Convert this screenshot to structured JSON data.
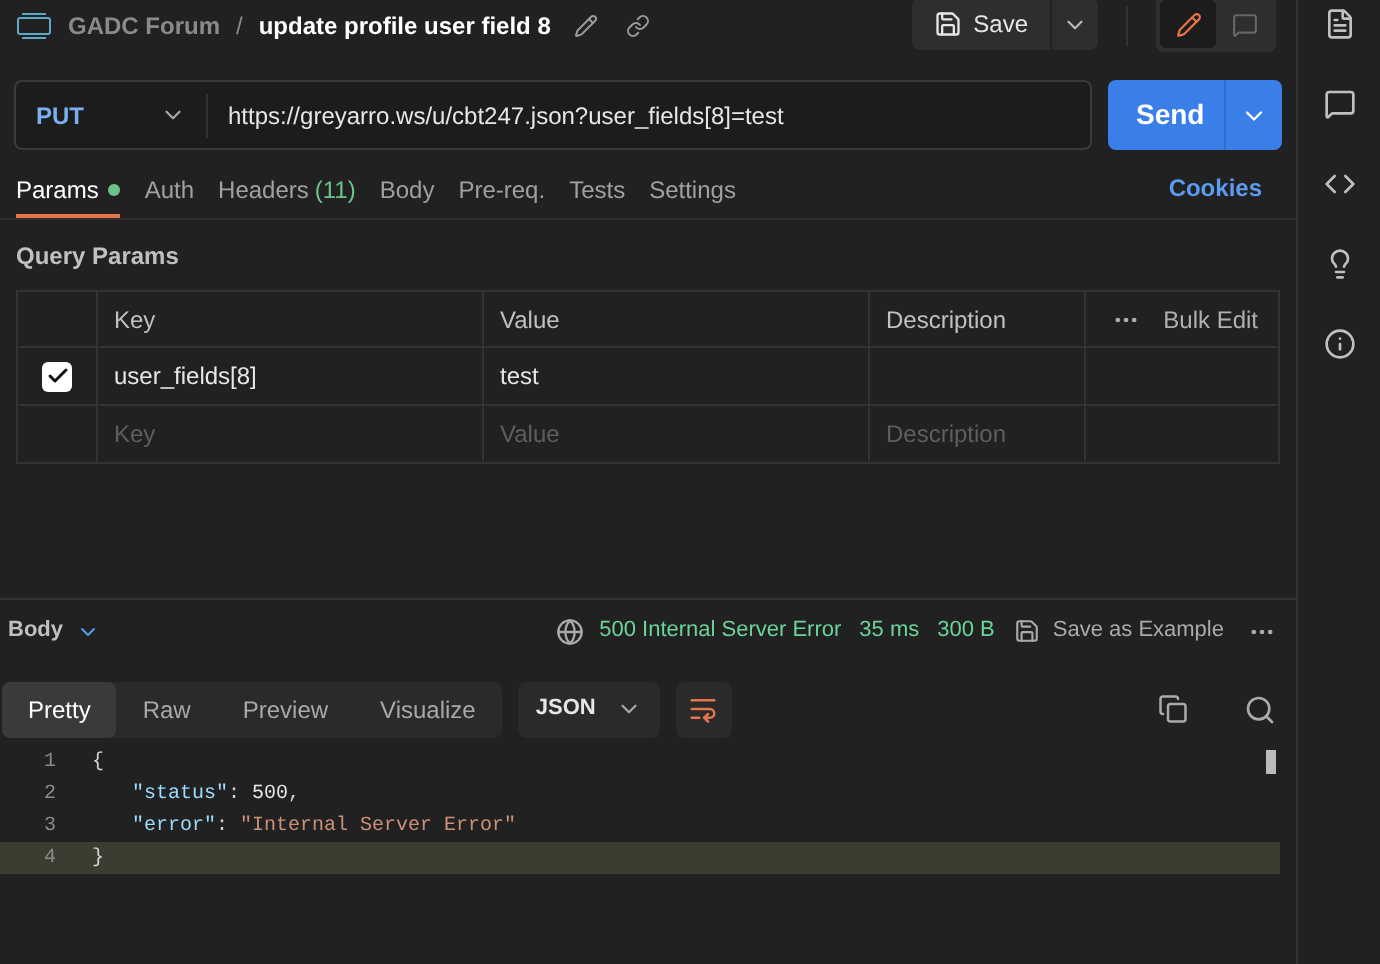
{
  "header": {
    "collection": "GADC Forum",
    "separator": "/",
    "request_name": "update profile user field 8",
    "save_label": "Save",
    "edit_mode": true
  },
  "request": {
    "method": "PUT",
    "url": "https://greyarro.ws/u/cbt247.json?user_fields[8]=test",
    "send_label": "Send"
  },
  "tabs": [
    {
      "label": "Params",
      "selected": true,
      "dot": true
    },
    {
      "label": "Auth",
      "selected": false
    },
    {
      "label": "Headers",
      "count": "(11)",
      "selected": false
    },
    {
      "label": "Body",
      "selected": false
    },
    {
      "label": "Pre-req.",
      "selected": false
    },
    {
      "label": "Tests",
      "selected": false
    },
    {
      "label": "Settings",
      "selected": false
    }
  ],
  "cookies_link": "Cookies",
  "query_params": {
    "title": "Query Params",
    "columns": [
      "Key",
      "Value",
      "Description"
    ],
    "bulk_edit": "Bulk Edit",
    "rows": [
      {
        "checked": true,
        "key": "user_fields[8]",
        "value": "test"
      }
    ],
    "placeholders": {
      "key": "Key",
      "value": "Value",
      "description": "Description"
    }
  },
  "response": {
    "section_label": "Body",
    "status": "500 Internal Server Error",
    "time": "35 ms",
    "size": "300 B",
    "save_example": "Save as Example",
    "view_tabs": [
      {
        "label": "Pretty",
        "selected": true
      },
      {
        "label": "Raw",
        "selected": false
      },
      {
        "label": "Preview",
        "selected": false
      },
      {
        "label": "Visualize",
        "selected": false
      }
    ],
    "format": "JSON",
    "lines": [
      {
        "number": "1",
        "current": false,
        "tokens": [
          {
            "kind": "bracket",
            "text": "{"
          }
        ]
      },
      {
        "number": "2",
        "current": false,
        "tokens": [
          {
            "kind": "key",
            "text": "\"status\""
          },
          {
            "kind": "punct",
            "text": ": "
          },
          {
            "kind": "number",
            "text": "500"
          },
          {
            "kind": "punct",
            "text": ","
          }
        ]
      },
      {
        "number": "3",
        "current": false,
        "tokens": [
          {
            "kind": "key",
            "text": "\"error\""
          },
          {
            "kind": "punct",
            "text": ": "
          },
          {
            "kind": "string",
            "text": "\"Internal Server Error\""
          }
        ]
      },
      {
        "number": "4",
        "current": true,
        "tokens": [
          {
            "kind": "bracket",
            "text": "}"
          }
        ]
      }
    ]
  }
}
